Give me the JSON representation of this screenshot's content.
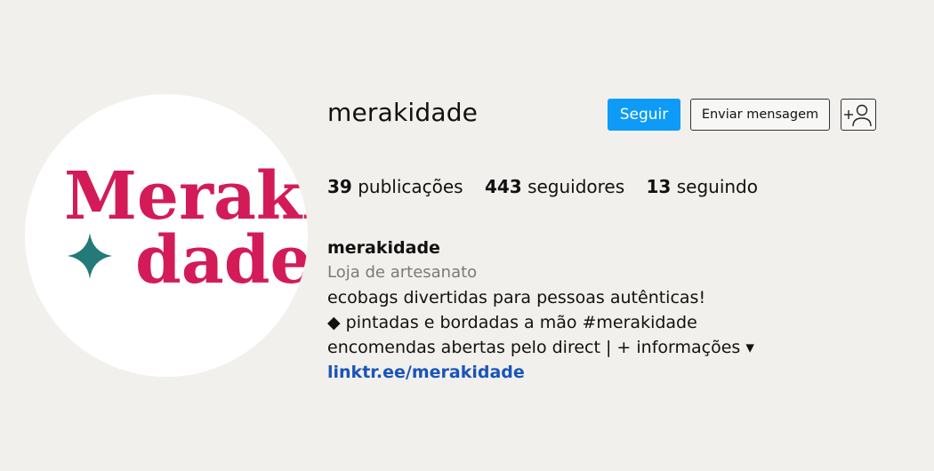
{
  "profile": {
    "username": "merakidade",
    "logo_line1": "Meraki",
    "logo_line2": "dade"
  },
  "actions": {
    "follow_label": "Seguir",
    "message_label": "Enviar mensagem",
    "add_user_icon": "add-user-icon"
  },
  "stats": {
    "posts_count": "39",
    "posts_label": "publicações",
    "followers_count": "443",
    "followers_label": "seguidores",
    "following_count": "13",
    "following_label": "seguindo"
  },
  "bio": {
    "name": "merakidade",
    "category": "Loja de artesanato",
    "line1": "ecobags divertidas para pessoas autênticas!",
    "line2": "◆ pintadas e bordadas a mão #merakidade",
    "line3": "encomendas abertas pelo direct | + informações ▾",
    "link": "linktr.ee/merakidade"
  },
  "colors": {
    "background": "#f1f0ec",
    "brand_pink": "#d31b58",
    "brand_teal": "#237a78",
    "follow_blue": "#0d9bf7",
    "link_blue": "#1a54b8"
  }
}
